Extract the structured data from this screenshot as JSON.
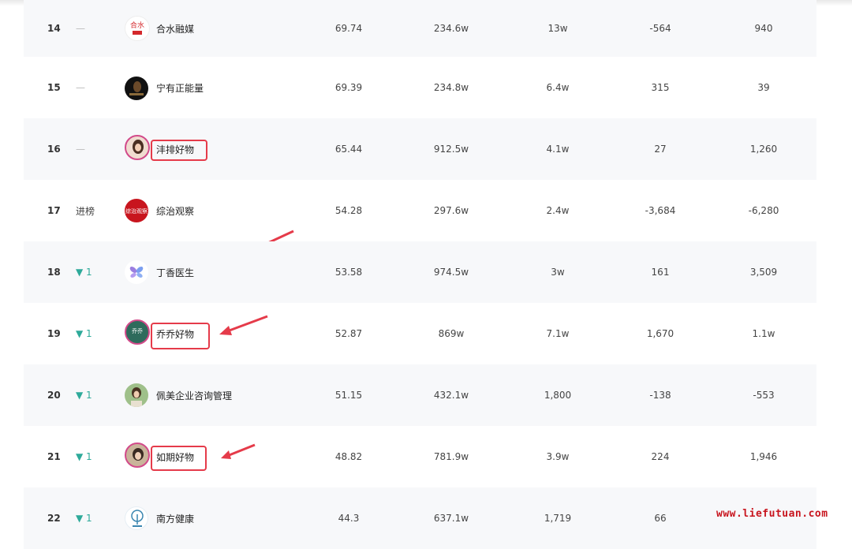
{
  "rows": [
    {
      "rank": "14",
      "trend": "—",
      "trend_type": "flat",
      "name": "合水融媒",
      "v1": "69.74",
      "v2": "234.6w",
      "v3": "13w",
      "v4": "-564",
      "v5": "940",
      "avatar_text": "合水"
    },
    {
      "rank": "15",
      "trend": "—",
      "trend_type": "flat",
      "name": "宁有正能量",
      "v1": "69.39",
      "v2": "234.8w",
      "v3": "6.4w",
      "v4": "315",
      "v5": "39",
      "avatar_text": ""
    },
    {
      "rank": "16",
      "trend": "—",
      "trend_type": "flat",
      "name": "沣排好物",
      "v1": "65.44",
      "v2": "912.5w",
      "v3": "4.1w",
      "v4": "27",
      "v5": "1,260",
      "avatar_text": ""
    },
    {
      "rank": "17",
      "trend": "进榜",
      "trend_type": "new",
      "name": "综治观察",
      "v1": "54.28",
      "v2": "297.6w",
      "v3": "2.4w",
      "v4": "-3,684",
      "v5": "-6,280",
      "avatar_text": "综治观察"
    },
    {
      "rank": "18",
      "trend": "▼ 1",
      "trend_type": "down",
      "name": "丁香医生",
      "v1": "53.58",
      "v2": "974.5w",
      "v3": "3w",
      "v4": "161",
      "v5": "3,509",
      "avatar_text": ""
    },
    {
      "rank": "19",
      "trend": "▼ 1",
      "trend_type": "down",
      "name": "乔乔好物",
      "v1": "52.87",
      "v2": "869w",
      "v3": "7.1w",
      "v4": "1,670",
      "v5": "1.1w",
      "avatar_text": "乔乔"
    },
    {
      "rank": "20",
      "trend": "▼ 1",
      "trend_type": "down",
      "name": "佩美企业咨询管理",
      "v1": "51.15",
      "v2": "432.1w",
      "v3": "1,800",
      "v4": "-138",
      "v5": "-553",
      "avatar_text": ""
    },
    {
      "rank": "21",
      "trend": "▼ 1",
      "trend_type": "down",
      "name": "如期好物",
      "v1": "48.82",
      "v2": "781.9w",
      "v3": "3.9w",
      "v4": "224",
      "v5": "1,946",
      "avatar_text": ""
    },
    {
      "rank": "22",
      "trend": "▼ 1",
      "trend_type": "down",
      "name": "南方健康",
      "v1": "44.3",
      "v2": "637.1w",
      "v3": "1,719",
      "v4": "66",
      "v5": "",
      "avatar_text": ""
    }
  ],
  "watermark": "www.liefutuan.com",
  "colors": {
    "highlight": "#e53b4a",
    "trend_down": "#2eaa9a",
    "watermark": "#c8151e"
  }
}
